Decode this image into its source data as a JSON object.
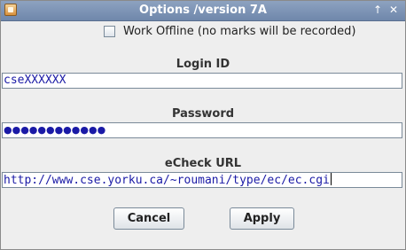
{
  "window": {
    "title": "Options /version 7A",
    "maximize_glyph": "↑",
    "close_glyph": "✕"
  },
  "offline": {
    "label": "Work Offline (no marks will be recorded)",
    "checked": false
  },
  "login": {
    "label": "Login ID",
    "value": "cseXXXXXX"
  },
  "password": {
    "label": "Password",
    "masked_value": "●●●●●●●●●●●●"
  },
  "echeck": {
    "label": "eCheck URL",
    "value": "http://www.cse.yorku.ca/~roumani/type/ec/ec.cgi"
  },
  "buttons": {
    "cancel": "Cancel",
    "apply": "Apply"
  },
  "colors": {
    "titlebar": "#7a90b4",
    "field_text": "#1a1aa6",
    "background": "#eeeeee"
  }
}
